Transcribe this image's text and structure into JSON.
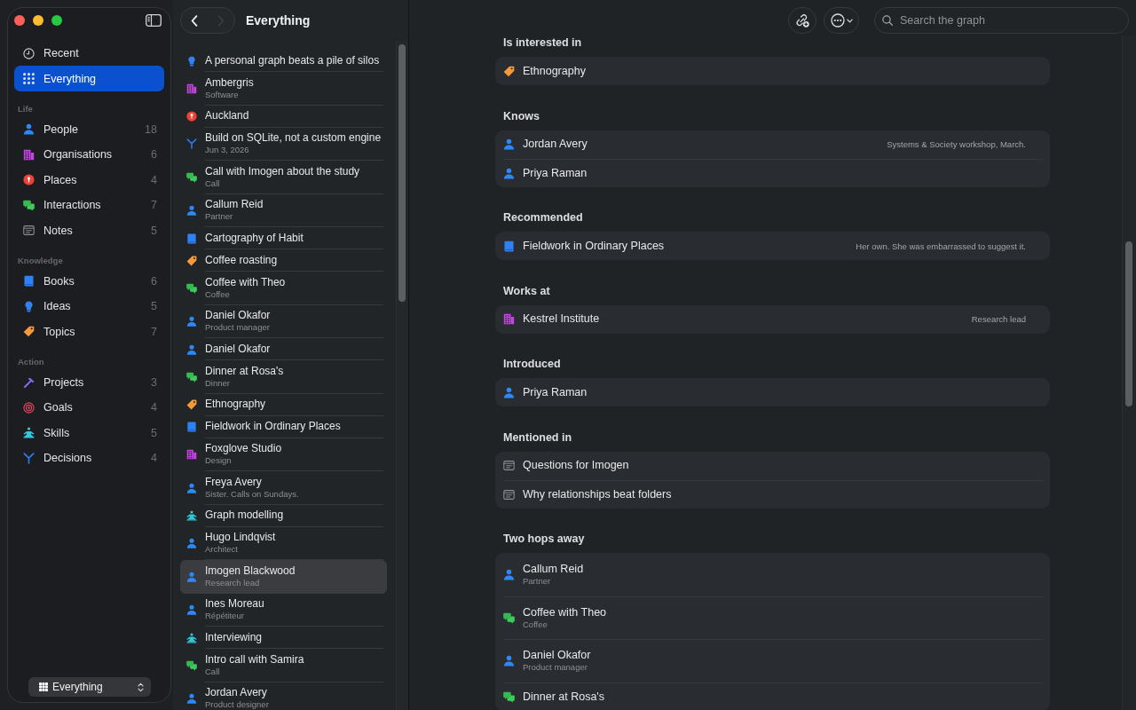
{
  "sidebar": {
    "items": [
      {
        "kind": "recent",
        "label": "Recent",
        "selected": false
      },
      {
        "kind": "everything",
        "label": "Everything",
        "selected": true
      }
    ],
    "sections": [
      {
        "title": "Life",
        "items": [
          {
            "kind": "person",
            "label": "People",
            "count": "18",
            "selected": false
          },
          {
            "kind": "organisation",
            "label": "Organisations",
            "count": "6",
            "selected": false
          },
          {
            "kind": "place",
            "label": "Places",
            "count": "4",
            "selected": false
          },
          {
            "kind": "interaction",
            "label": "Interactions",
            "count": "7",
            "selected": false
          },
          {
            "kind": "note",
            "label": "Notes",
            "count": "5",
            "selected": false
          }
        ]
      },
      {
        "title": "Knowledge",
        "items": [
          {
            "kind": "book",
            "label": "Books",
            "count": "6",
            "selected": false
          },
          {
            "kind": "idea",
            "label": "Ideas",
            "count": "5",
            "selected": false
          },
          {
            "kind": "topic",
            "label": "Topics",
            "count": "7",
            "selected": false
          }
        ]
      },
      {
        "title": "Action",
        "items": [
          {
            "kind": "project",
            "label": "Projects",
            "count": "3",
            "selected": false
          },
          {
            "kind": "goal",
            "label": "Goals",
            "count": "4",
            "selected": false
          },
          {
            "kind": "skill",
            "label": "Skills",
            "count": "5",
            "selected": false
          },
          {
            "kind": "decision",
            "label": "Decisions",
            "count": "4",
            "selected": false
          }
        ]
      }
    ],
    "scope_picker": {
      "label": "Everything"
    }
  },
  "list": {
    "nav": [
      {
        "kind": "back",
        "disabled": false
      },
      {
        "kind": "forward",
        "disabled": true
      }
    ],
    "title": "Everything",
    "rows": [
      {
        "kind": "idea",
        "title": "A personal graph beats a pile of silos",
        "selected": false
      },
      {
        "kind": "organisation",
        "title": "Ambergris",
        "subtitle": "Software",
        "selected": false
      },
      {
        "kind": "place",
        "title": "Auckland",
        "selected": false
      },
      {
        "kind": "decision",
        "title": "Build on SQLite, not a custom engine",
        "subtitle": "Jun 3, 2026",
        "selected": false
      },
      {
        "kind": "interaction",
        "title": "Call with Imogen about the study",
        "subtitle": "Call",
        "selected": false
      },
      {
        "kind": "person",
        "title": "Callum Reid",
        "subtitle": "Partner",
        "selected": false
      },
      {
        "kind": "book",
        "title": "Cartography of Habit",
        "selected": false
      },
      {
        "kind": "topic",
        "title": "Coffee roasting",
        "selected": false
      },
      {
        "kind": "interaction",
        "title": "Coffee with Theo",
        "subtitle": "Coffee",
        "selected": false
      },
      {
        "kind": "person",
        "title": "Daniel Okafor",
        "subtitle": "Product manager",
        "selected": false
      },
      {
        "kind": "person",
        "title": "Daniel Okafor",
        "selected": false
      },
      {
        "kind": "interaction",
        "title": "Dinner at Rosa's",
        "subtitle": "Dinner",
        "selected": false
      },
      {
        "kind": "topic",
        "title": "Ethnography",
        "selected": false
      },
      {
        "kind": "book",
        "title": "Fieldwork in Ordinary Places",
        "selected": false
      },
      {
        "kind": "organisation",
        "title": "Foxglove Studio",
        "subtitle": "Design",
        "selected": false
      },
      {
        "kind": "person",
        "title": "Freya Avery",
        "subtitle": "Sister. Calls on Sundays.",
        "selected": false
      },
      {
        "kind": "skill",
        "title": "Graph modelling",
        "selected": false
      },
      {
        "kind": "person",
        "title": "Hugo Lindqvist",
        "subtitle": "Architect",
        "selected": false
      },
      {
        "kind": "person",
        "title": "Imogen Blackwood",
        "subtitle": "Research lead",
        "selected": true
      },
      {
        "kind": "person",
        "title": "Ines Moreau",
        "subtitle": "Répétiteur",
        "selected": false
      },
      {
        "kind": "skill",
        "title": "Interviewing",
        "selected": false
      },
      {
        "kind": "interaction",
        "title": "Intro call with Samira",
        "subtitle": "Call",
        "selected": false
      },
      {
        "kind": "person",
        "title": "Jordan Avery",
        "subtitle": "Product designer",
        "selected": false
      }
    ]
  },
  "detail": {
    "search": {
      "placeholder": "Search the graph"
    },
    "sections": [
      {
        "title": "Is interested in",
        "rows": [
          {
            "kind": "topic",
            "title": "Ethnography"
          }
        ]
      },
      {
        "title": "Knows",
        "rows": [
          {
            "kind": "person",
            "title": "Jordan Avery",
            "note": "Systems & Society workshop, March."
          },
          {
            "kind": "person",
            "title": "Priya Raman"
          }
        ]
      },
      {
        "title": "Recommended",
        "rows": [
          {
            "kind": "book",
            "title": "Fieldwork in Ordinary Places",
            "note": "Her own. She was embarrassed to suggest it."
          }
        ]
      },
      {
        "title": "Works at",
        "rows": [
          {
            "kind": "organisation",
            "title": "Kestrel Institute",
            "note": "Research lead"
          }
        ]
      },
      {
        "title": "Introduced",
        "rows": [
          {
            "kind": "person",
            "title": "Priya Raman"
          }
        ]
      },
      {
        "title": "Mentioned in",
        "rows": [
          {
            "kind": "note",
            "title": "Questions for Imogen"
          },
          {
            "kind": "note",
            "title": "Why relationships beat folders"
          }
        ]
      },
      {
        "title": "Two hops away",
        "rows": [
          {
            "kind": "person",
            "title": "Callum Reid",
            "subtitle": "Partner"
          },
          {
            "kind": "interaction",
            "title": "Coffee with Theo",
            "subtitle": "Coffee"
          },
          {
            "kind": "person",
            "title": "Daniel Okafor",
            "subtitle": "Product manager"
          },
          {
            "kind": "interaction",
            "title": "Dinner at Rosa's"
          }
        ]
      }
    ]
  }
}
